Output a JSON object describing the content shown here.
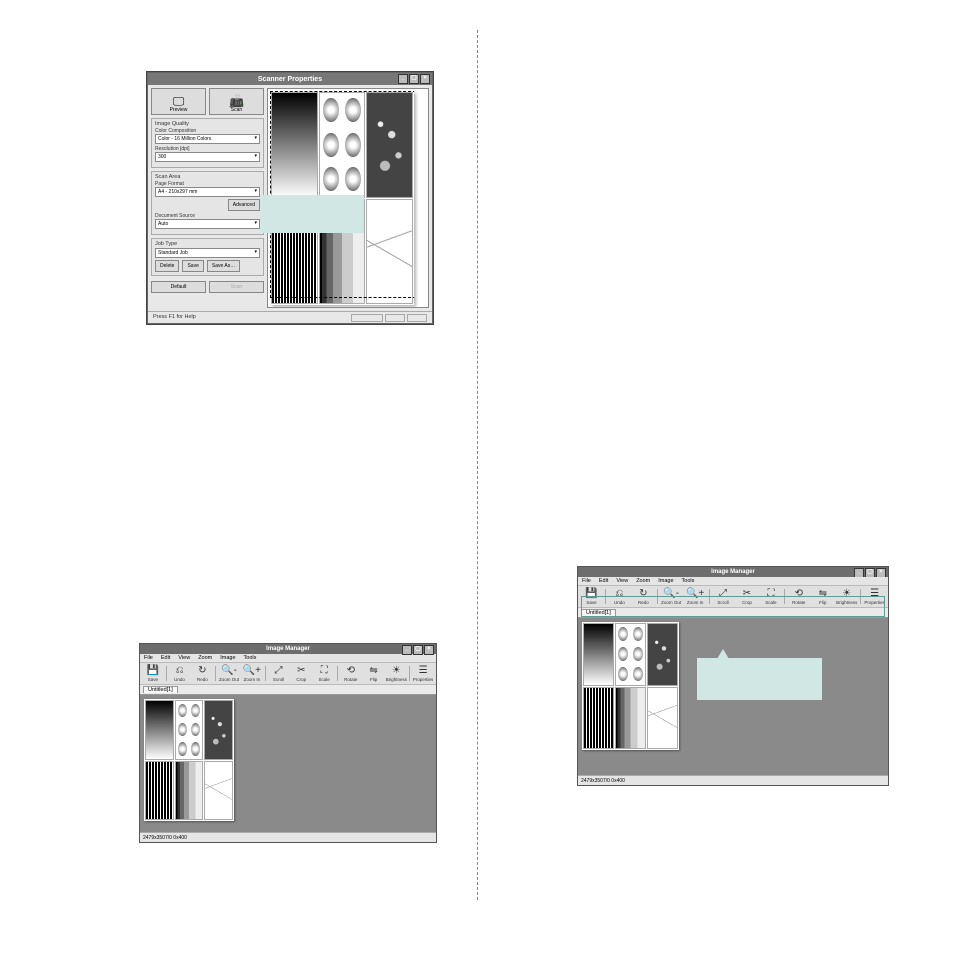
{
  "scanner": {
    "title": "Scanner Properties",
    "preview_btn": "Preview",
    "scan_btn": "Scan",
    "group_quality": "Image Quality",
    "label_colorcomp": "Color Composition",
    "value_colorcomp": "Color - 16 Million Colors",
    "label_resolution": "Resolution [dpi]",
    "value_resolution": "300",
    "group_scanarea": "Scan Area",
    "label_pageformat": "Page Format",
    "value_pageformat": "A4 - 210x297 mm",
    "advanced_btn": "Advanced",
    "label_docsource": "Document Source",
    "value_docsource": "Auto",
    "group_jobtype": "Job Type",
    "value_jobtype": "Standard Job",
    "delete_btn": "Delete",
    "save_btn": "Save",
    "saveas_btn": "Save As…",
    "default_btn": "Default",
    "scan2_btn": "Scan",
    "status": "Press F1 for Help"
  },
  "image_manager": {
    "title": "Image Manager",
    "menus": [
      "File",
      "Edit",
      "View",
      "Zoom",
      "Image",
      "Tools"
    ],
    "tools": [
      {
        "icon": "💾",
        "label": "Save"
      },
      {
        "icon": "⎌",
        "label": "Undo"
      },
      {
        "icon": "↻",
        "label": "Redo"
      },
      {
        "icon": "🔍-",
        "label": "Zoom Out"
      },
      {
        "icon": "🔍+",
        "label": "Zoom In"
      },
      {
        "icon": "⤢",
        "label": "Scroll"
      },
      {
        "icon": "✂",
        "label": "Crop"
      },
      {
        "icon": "⛶",
        "label": "Scale"
      },
      {
        "icon": "⟲",
        "label": "Rotate"
      },
      {
        "icon": "⇋",
        "label": "Flip"
      },
      {
        "icon": "☀",
        "label": "Brightness"
      },
      {
        "icon": "☰",
        "label": "Properties"
      }
    ],
    "tab": "Untitled[1]",
    "status": "2479x3507/0 0x400"
  }
}
